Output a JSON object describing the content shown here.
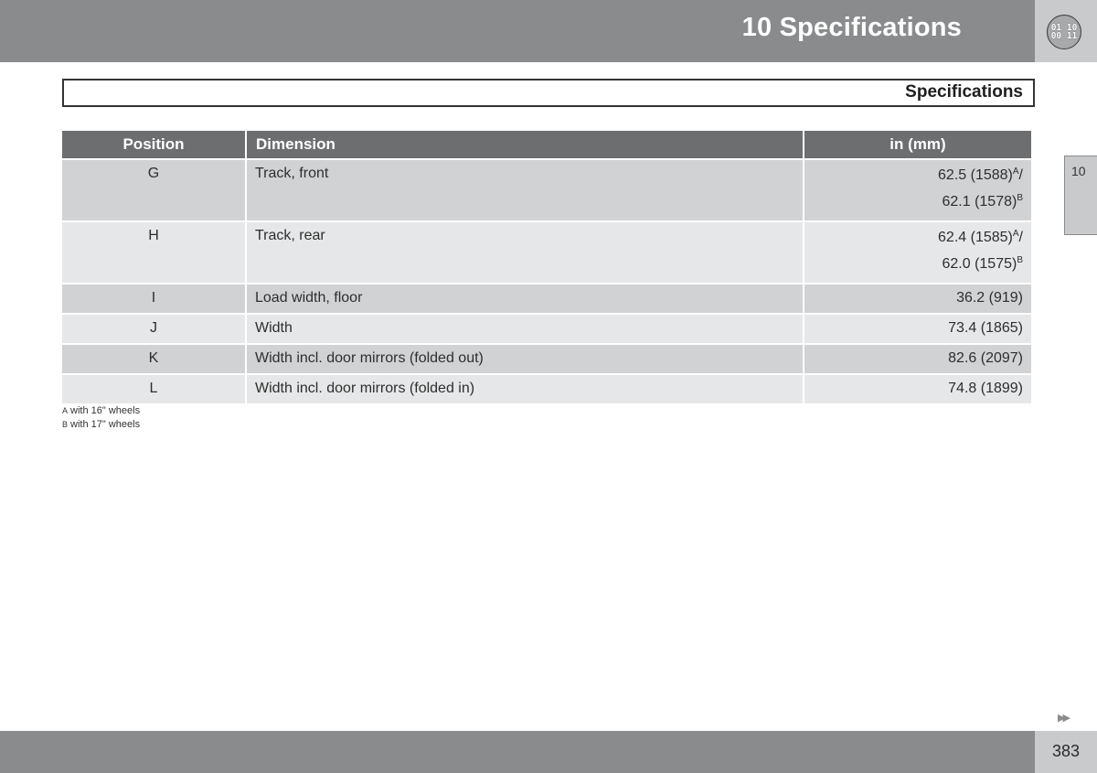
{
  "header": {
    "chapter_title": "10  Specifications",
    "icon": "binary-digits-icon",
    "icon_lines": [
      "01 10",
      "00 11"
    ]
  },
  "section": {
    "title": "Specifications"
  },
  "side_tab": {
    "label": "10"
  },
  "table": {
    "columns": [
      "Position",
      "Dimension",
      "in (mm)"
    ],
    "rows": [
      {
        "position": "G",
        "dimension": "Track, front",
        "value_a": "62.5 (1588)",
        "sup_a": "A",
        "sep": "/",
        "value_b": "62.1 (1578)",
        "sup_b": "B"
      },
      {
        "position": "H",
        "dimension": "Track, rear",
        "value_a": "62.4 (1585)",
        "sup_a": "A",
        "sep": "/",
        "value_b": "62.0 (1575)",
        "sup_b": "B"
      },
      {
        "position": "I",
        "dimension": "Load width, floor",
        "value": "36.2 (919)"
      },
      {
        "position": "J",
        "dimension": "Width",
        "value": "73.4 (1865)"
      },
      {
        "position": "K",
        "dimension": "Width incl. door mirrors (folded out)",
        "value": "82.6 (2097)"
      },
      {
        "position": "L",
        "dimension": "Width incl. door mirrors (folded in)",
        "value": "74.8 (1899)"
      }
    ]
  },
  "footnotes": [
    {
      "mark": "A",
      "text": "with 16\" wheels"
    },
    {
      "mark": "B",
      "text": "with 17\" wheels"
    }
  ],
  "footer": {
    "next_icon": "double-arrow-right-icon",
    "next_glyph": "▶▶",
    "page_number": "383"
  },
  "colors": {
    "header_bar": "#8a8b8d",
    "table_header": "#6d6e70",
    "row_dark": "#d1d2d3",
    "row_light": "#e6e7e8",
    "side_box": "#c9cacb"
  }
}
